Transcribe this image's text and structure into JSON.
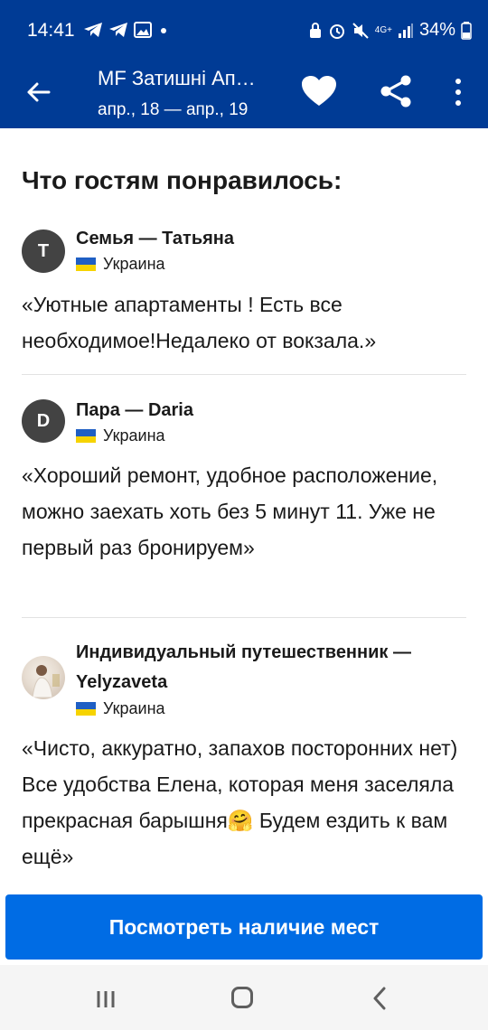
{
  "status_bar": {
    "time": "14:41",
    "battery": "34%",
    "network": "4G+",
    "icons": [
      "telegram-icon",
      "telegram-icon",
      "gallery-icon",
      "dot-icon",
      "lock-icon",
      "alarm-icon",
      "mute-icon",
      "signal-icon",
      "battery-icon"
    ]
  },
  "app_bar": {
    "title": "MF Затишні Ап…",
    "subtitle": "апр., 18 — апр., 19"
  },
  "section": {
    "title": "Что гостям понравилось:"
  },
  "reviews": [
    {
      "initial": "T",
      "name": "Семья — Татьяна",
      "country": "Украина",
      "text": "«Уютные апартаменты ! Есть все необходимое!Недалеко от вокзала.»"
    },
    {
      "initial": "D",
      "name": "Пара — Daria",
      "country": "Украина",
      "text": "«Хороший ремонт, удобное расположение, можно заехать хоть без 5 минут 11. Уже не первый раз бронируем»"
    },
    {
      "initial": "",
      "name_line1": "Индивидуальный путешественник —",
      "name_line2": "Yelyzaveta",
      "country": "Украина",
      "text": "«Чисто, аккуратно, запахов посторонних нет) Все удобства Елена, которая меня заселяла прекрасная барышня🤗 Будем ездить к вам ещё»"
    }
  ],
  "cta": {
    "label": "Посмотреть наличие мест"
  },
  "colors": {
    "brand_dark": "#003b95",
    "brand_button": "#006ce4"
  }
}
